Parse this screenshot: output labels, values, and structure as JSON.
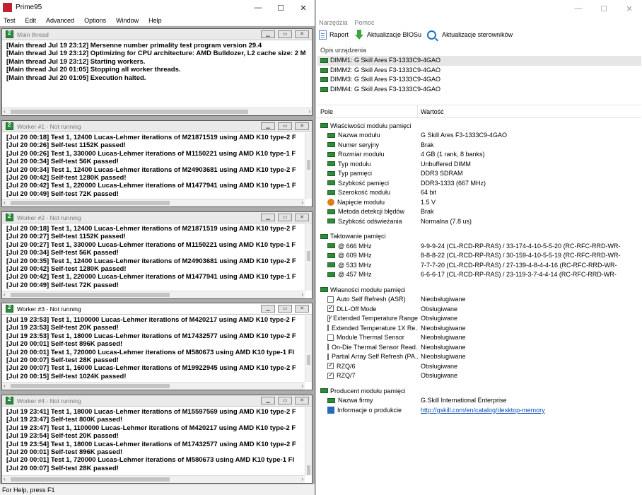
{
  "prime95": {
    "title": "Prime95",
    "menu": [
      "Test",
      "Edit",
      "Advanced",
      "Options",
      "Window",
      "Help"
    ],
    "status": "For Help, press F1",
    "windows": [
      {
        "title": "Main thread",
        "lines": [
          "[Main thread Jul 19 23:12] Mersenne number primality test program version 29.4",
          "[Main thread Jul 19 23:12] Optimizing for CPU architecture: AMD Bulldozer, L2 cache size: 2 M",
          "[Main thread Jul 19 23:12] Starting workers.",
          "[Main thread Jul 20 01:05] Stopping all worker threads.",
          "[Main thread Jul 20 01:05] Execution halted."
        ]
      },
      {
        "title": "Worker #1 - Not running",
        "lines": [
          "[Jul 20 00:18] Test 1, 12400 Lucas-Lehmer iterations of M21871519 using AMD K10 type-2 F",
          "[Jul 20 00:26] Self-test 1152K passed!",
          "[Jul 20 00:26] Test 1, 330000 Lucas-Lehmer iterations of M1150221 using AMD K10 type-1 F",
          "[Jul 20 00:34] Self-test 56K passed!",
          "[Jul 20 00:34] Test 1, 12400 Lucas-Lehmer iterations of M24903681 using AMD K10 type-2 F",
          "[Jul 20 00:42] Self-test 1280K passed!",
          "[Jul 20 00:42] Test 1, 220000 Lucas-Lehmer iterations of M1477941 using AMD K10 type-1 F",
          "[Jul 20 00:49] Self-test 72K passed!"
        ]
      },
      {
        "title": "Worker #2 - Not running",
        "lines": [
          "[Jul 20 00:18] Test 1, 12400 Lucas-Lehmer iterations of M21871519 using AMD K10 type-2 F",
          "[Jul 20 00:27] Self-test 1152K passed!",
          "[Jul 20 00:27] Test 1, 330000 Lucas-Lehmer iterations of M1150221 using AMD K10 type-1 F",
          "[Jul 20 00:34] Self-test 56K passed!",
          "[Jul 20 00:35] Test 1, 12400 Lucas-Lehmer iterations of M24903681 using AMD K10 type-2 F",
          "[Jul 20 00:42] Self-test 1280K passed!",
          "[Jul 20 00:42] Test 1, 220000 Lucas-Lehmer iterations of M1477941 using AMD K10 type-1 F",
          "[Jul 20 00:49] Self-test 72K passed!"
        ]
      },
      {
        "title": "Worker #3 - Not running",
        "lines": [
          "[Jul 19 23:53] Test 1, 1100000 Lucas-Lehmer iterations of M420217 using AMD K10 type-2 F",
          "[Jul 19 23:53] Self-test 20K passed!",
          "[Jul 19 23:53] Test 1, 18000 Lucas-Lehmer iterations of M17432577 using AMD K10 type-2 F",
          "[Jul 20 00:01] Self-test 896K passed!",
          "[Jul 20 00:01] Test 1, 720000 Lucas-Lehmer iterations of M580673 using AMD K10 type-1 FI",
          "[Jul 20 00:07] Self-test 28K passed!",
          "[Jul 20 00:07] Test 1, 16000 Lucas-Lehmer iterations of M19922945 using AMD K10 type-2 F",
          "[Jul 20 00:15] Self-test 1024K passed!"
        ]
      },
      {
        "title": "Worker #4 - Not running",
        "lines": [
          "[Jul 19 23:41] Test 1, 18000 Lucas-Lehmer iterations of M15597569 using AMD K10 type-2 F",
          "[Jul 19 23:47] Self-test 800K passed!",
          "[Jul 19 23:47] Test 1, 1100000 Lucas-Lehmer iterations of M420217 using AMD K10 type-2 F",
          "[Jul 19 23:54] Self-test 20K passed!",
          "[Jul 19 23:54] Test 1, 18000 Lucas-Lehmer iterations of M17432577 using AMD K10 type-2 F",
          "[Jul 20 00:01] Self-test 896K passed!",
          "[Jul 20 00:01] Test 1, 720000 Lucas-Lehmer iterations of M580673 using AMD K10 type-1 FI",
          "[Jul 20 00:07] Self-test 28K passed!"
        ]
      }
    ]
  },
  "aida": {
    "menu": [
      "Narzędzia",
      "Pomoc"
    ],
    "toolbar": {
      "report": "Raport",
      "bios": "Aktualizacje BIOSu",
      "drivers": "Aktualizacje sterowników"
    },
    "device_section": "Opis urządzenia",
    "devices": [
      "DIMM1: G Skill Ares F3-1333C9-4GAO",
      "DIMM2: G Skill Ares F3-1333C9-4GAO",
      "DIMM3: G Skill Ares F3-1333C9-4GAO",
      "DIMM4: G Skill Ares F3-1333C9-4GAO"
    ],
    "columns": {
      "field": "Pole",
      "value": "Wartość"
    },
    "groups": [
      {
        "title": "Właściwości modułu pamięci",
        "rows": [
          {
            "k": "Nazwa modułu",
            "v": "G Skill Ares F3-1333C9-4GAO",
            "icon": "chip"
          },
          {
            "k": "Numer seryjny",
            "v": "Brak",
            "icon": "chip"
          },
          {
            "k": "Rozmiar modułu",
            "v": "4 GB (1 rank, 8 banks)",
            "icon": "chip"
          },
          {
            "k": "Typ modułu",
            "v": "Unbuffered DIMM",
            "icon": "chip"
          },
          {
            "k": "Typ pamięci",
            "v": "DDR3 SDRAM",
            "icon": "chip"
          },
          {
            "k": "Szybkość pamięci",
            "v": "DDR3-1333 (667 MHz)",
            "icon": "chip"
          },
          {
            "k": "Szerokość modułu",
            "v": "64 bit",
            "icon": "chip"
          },
          {
            "k": "Napięcie modułu",
            "v": "1.5 V",
            "icon": "warn"
          },
          {
            "k": "Metoda detekcji błędów",
            "v": "Brak",
            "icon": "chip"
          },
          {
            "k": "Szybkość odświeżania",
            "v": "Normalna (7.8 us)",
            "icon": "chip"
          }
        ]
      },
      {
        "title": "Taktowanie pamięci",
        "rows": [
          {
            "k": "@ 666 MHz",
            "v": "9-9-9-24  (CL-RCD-RP-RAS) / 33-174-4-10-5-5-20  (RC-RFC-RRD-WR-",
            "icon": "chip"
          },
          {
            "k": "@ 609 MHz",
            "v": "8-8-8-22  (CL-RCD-RP-RAS) / 30-159-4-10-5-5-19  (RC-RFC-RRD-WR-",
            "icon": "chip"
          },
          {
            "k": "@ 533 MHz",
            "v": "7-7-7-20  (CL-RCD-RP-RAS) / 27-139-4-8-4-4-16  (RC-RFC-RRD-WR-",
            "icon": "chip"
          },
          {
            "k": "@ 457 MHz",
            "v": "6-6-6-17  (CL-RCD-RP-RAS) / 23-119-3-7-4-4-14  (RC-RFC-RRD-WR-",
            "icon": "chip"
          }
        ]
      },
      {
        "title": "Własności modułu pamięci",
        "rows": [
          {
            "k": "Auto Self Refresh (ASR)",
            "v": "Nieobsługiwane",
            "icon": "cb-off"
          },
          {
            "k": "DLL-Off Mode",
            "v": "Obsługiwane",
            "icon": "cb-on"
          },
          {
            "k": "Extended Temperature Range",
            "v": "Obsługiwane",
            "icon": "cb-on"
          },
          {
            "k": "Extended Temperature 1X Re...",
            "v": "Nieobsługiwane",
            "icon": "cb-off"
          },
          {
            "k": "Module Thermal Sensor",
            "v": "Nieobsługiwane",
            "icon": "cb-off"
          },
          {
            "k": "On-Die Thermal Sensor Read...",
            "v": "Nieobsługiwane",
            "icon": "cb-off"
          },
          {
            "k": "Partial Array Self Refresh (PA...",
            "v": "Nieobsługiwane",
            "icon": "cb-off"
          },
          {
            "k": "RZQ/6",
            "v": "Obsługiwane",
            "icon": "cb-on"
          },
          {
            "k": "RZQ/7",
            "v": "Obsługiwane",
            "icon": "cb-on"
          }
        ]
      },
      {
        "title": "Producent modułu pamięci",
        "rows": [
          {
            "k": "Nazwa firmy",
            "v": "G.Skill International Enterprise",
            "icon": "chip"
          },
          {
            "k": "Informacje o produkcie",
            "v": "http://gskill.com/en/catalog/desktop-memory",
            "icon": "info",
            "link": true
          }
        ]
      }
    ]
  }
}
